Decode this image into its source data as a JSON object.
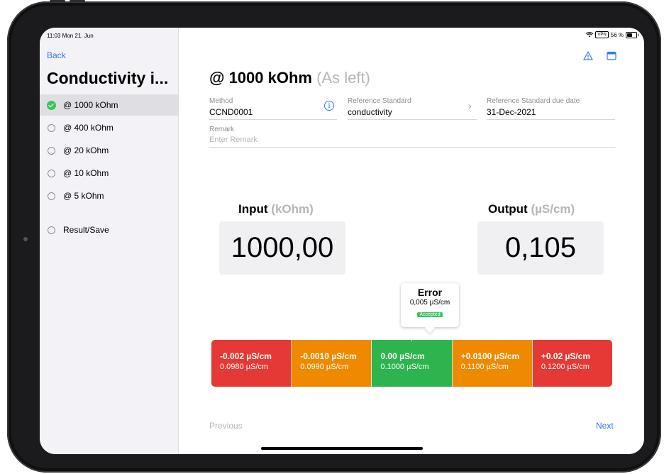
{
  "status_bar": {
    "time": "11:03 Mon 21. Jun",
    "vpn": "VPN",
    "battery": "56 %"
  },
  "sidebar": {
    "back_label": "Back",
    "title": "Conductivity i...",
    "items": [
      {
        "label": "@ 1000 kOhm",
        "selected": true
      },
      {
        "label": "@ 400 kOhm",
        "selected": false
      },
      {
        "label": "@ 20 kOhm",
        "selected": false
      },
      {
        "label": "@ 10 kOhm",
        "selected": false
      },
      {
        "label": "@ 5 kOhm",
        "selected": false
      },
      {
        "label": "Result/Save",
        "selected": false
      }
    ]
  },
  "toolbar": {
    "icons": [
      "warning-icon",
      "calendar-icon"
    ]
  },
  "page": {
    "title": "@ 1000 kOhm",
    "title_suffix": "(As left)",
    "method": {
      "label": "Method",
      "value": "CCND0001"
    },
    "reference_standard": {
      "label": "Reference Standard",
      "value": "conductivity"
    },
    "due_date": {
      "label": "Reference Standard due date",
      "value": "31-Dec-2021"
    },
    "remark": {
      "label": "Remark",
      "placeholder": "Enter Remark"
    }
  },
  "input": {
    "label": "Input",
    "unit": "(kOhm)",
    "value": "1000,00"
  },
  "output": {
    "label": "Output",
    "unit": "(µS/cm)",
    "value": "0,105"
  },
  "error": {
    "title": "Error",
    "value": "0,005 µS/cm",
    "status": "Accepted"
  },
  "scale": [
    {
      "top": "-0.002 µS/cm",
      "bottom": "0.0980 µS/cm",
      "color": "#e53935"
    },
    {
      "top": "-0.0010 µS/cm",
      "bottom": "0.0990 µS/cm",
      "color": "#ef8a00"
    },
    {
      "top": "0.00 µS/cm",
      "bottom": "0.1000 µS/cm",
      "color": "#2eb44e"
    },
    {
      "top": "+0.0100 µS/cm",
      "bottom": "0.1100 µS/cm",
      "color": "#ef8a00"
    },
    {
      "top": "+0.02 µS/cm",
      "bottom": "0.1200 µS/cm",
      "color": "#e53935"
    }
  ],
  "footer": {
    "previous": "Previous",
    "next": "Next"
  },
  "colors": {
    "accent": "#3478f6",
    "success": "#34c759"
  }
}
